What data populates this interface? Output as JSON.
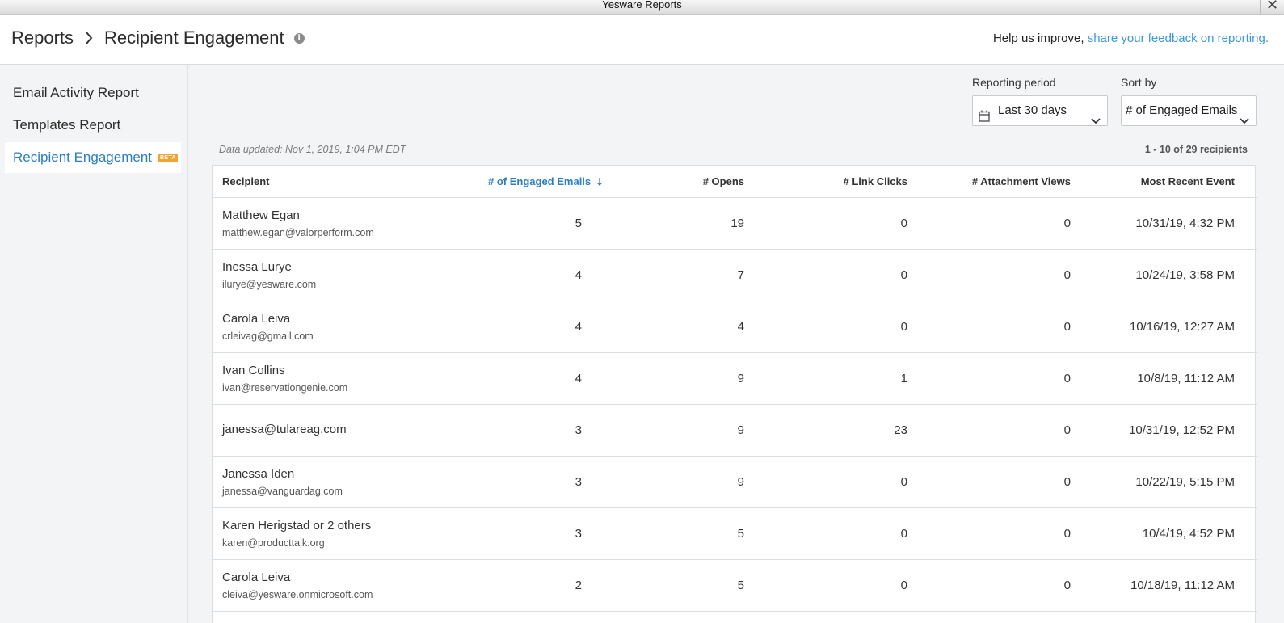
{
  "window": {
    "title": "Yesware Reports",
    "close": "✕"
  },
  "header": {
    "crumb_root": "Reports",
    "crumb_current": "Recipient Engagement",
    "info_glyph": "i",
    "feedback_prefix": "Help us improve,",
    "feedback_link": "share your feedback on reporting."
  },
  "sidebar": {
    "items": [
      {
        "label": "Email Activity Report"
      },
      {
        "label": "Templates Report"
      },
      {
        "label": "Recipient Engagement",
        "badge": "BETA"
      }
    ]
  },
  "controls": {
    "period_label": "Reporting period",
    "period_value": "Last 30 days",
    "sort_label": "Sort by",
    "sort_value": "# of Engaged Emails"
  },
  "status": {
    "updated": "Data updated: Nov 1, 2019, 1:04 PM EDT",
    "count": "1 - 10 of 29 recipients"
  },
  "table": {
    "headers": {
      "recipient": "Recipient",
      "engaged": "# of Engaged Emails",
      "opens": "# Opens",
      "clicks": "# Link Clicks",
      "attach": "# Attachment Views",
      "recent": "Most Recent Event"
    },
    "rows": [
      {
        "name": "Matthew Egan",
        "email": "matthew.egan@valorperform.com",
        "engaged": "5",
        "opens": "19",
        "clicks": "0",
        "attach": "0",
        "recent": "10/31/19, 4:32 PM"
      },
      {
        "name": "Inessa Lurye",
        "email": "ilurye@yesware.com",
        "engaged": "4",
        "opens": "7",
        "clicks": "0",
        "attach": "0",
        "recent": "10/24/19, 3:58 PM"
      },
      {
        "name": "Carola Leiva",
        "email": "crleivag@gmail.com",
        "engaged": "4",
        "opens": "4",
        "clicks": "0",
        "attach": "0",
        "recent": "10/16/19, 12:27 AM"
      },
      {
        "name": "Ivan Collins",
        "email": "ivan@reservationgenie.com",
        "engaged": "4",
        "opens": "9",
        "clicks": "1",
        "attach": "0",
        "recent": "10/8/19, 11:12 AM"
      },
      {
        "name": "janessa@tulareag.com",
        "email": "",
        "engaged": "3",
        "opens": "9",
        "clicks": "23",
        "attach": "0",
        "recent": "10/31/19, 12:52 PM"
      },
      {
        "name": "Janessa Iden",
        "email": "janessa@vanguardag.com",
        "engaged": "3",
        "opens": "9",
        "clicks": "0",
        "attach": "0",
        "recent": "10/22/19, 5:15 PM"
      },
      {
        "name": "Karen Herigstad or 2 others",
        "email": "karen@producttalk.org",
        "engaged": "3",
        "opens": "5",
        "clicks": "0",
        "attach": "0",
        "recent": "10/4/19, 4:52 PM"
      },
      {
        "name": "Carola Leiva",
        "email": "cleiva@yesware.onmicrosoft.com",
        "engaged": "2",
        "opens": "5",
        "clicks": "0",
        "attach": "0",
        "recent": "10/18/19, 11:12 AM"
      }
    ]
  }
}
